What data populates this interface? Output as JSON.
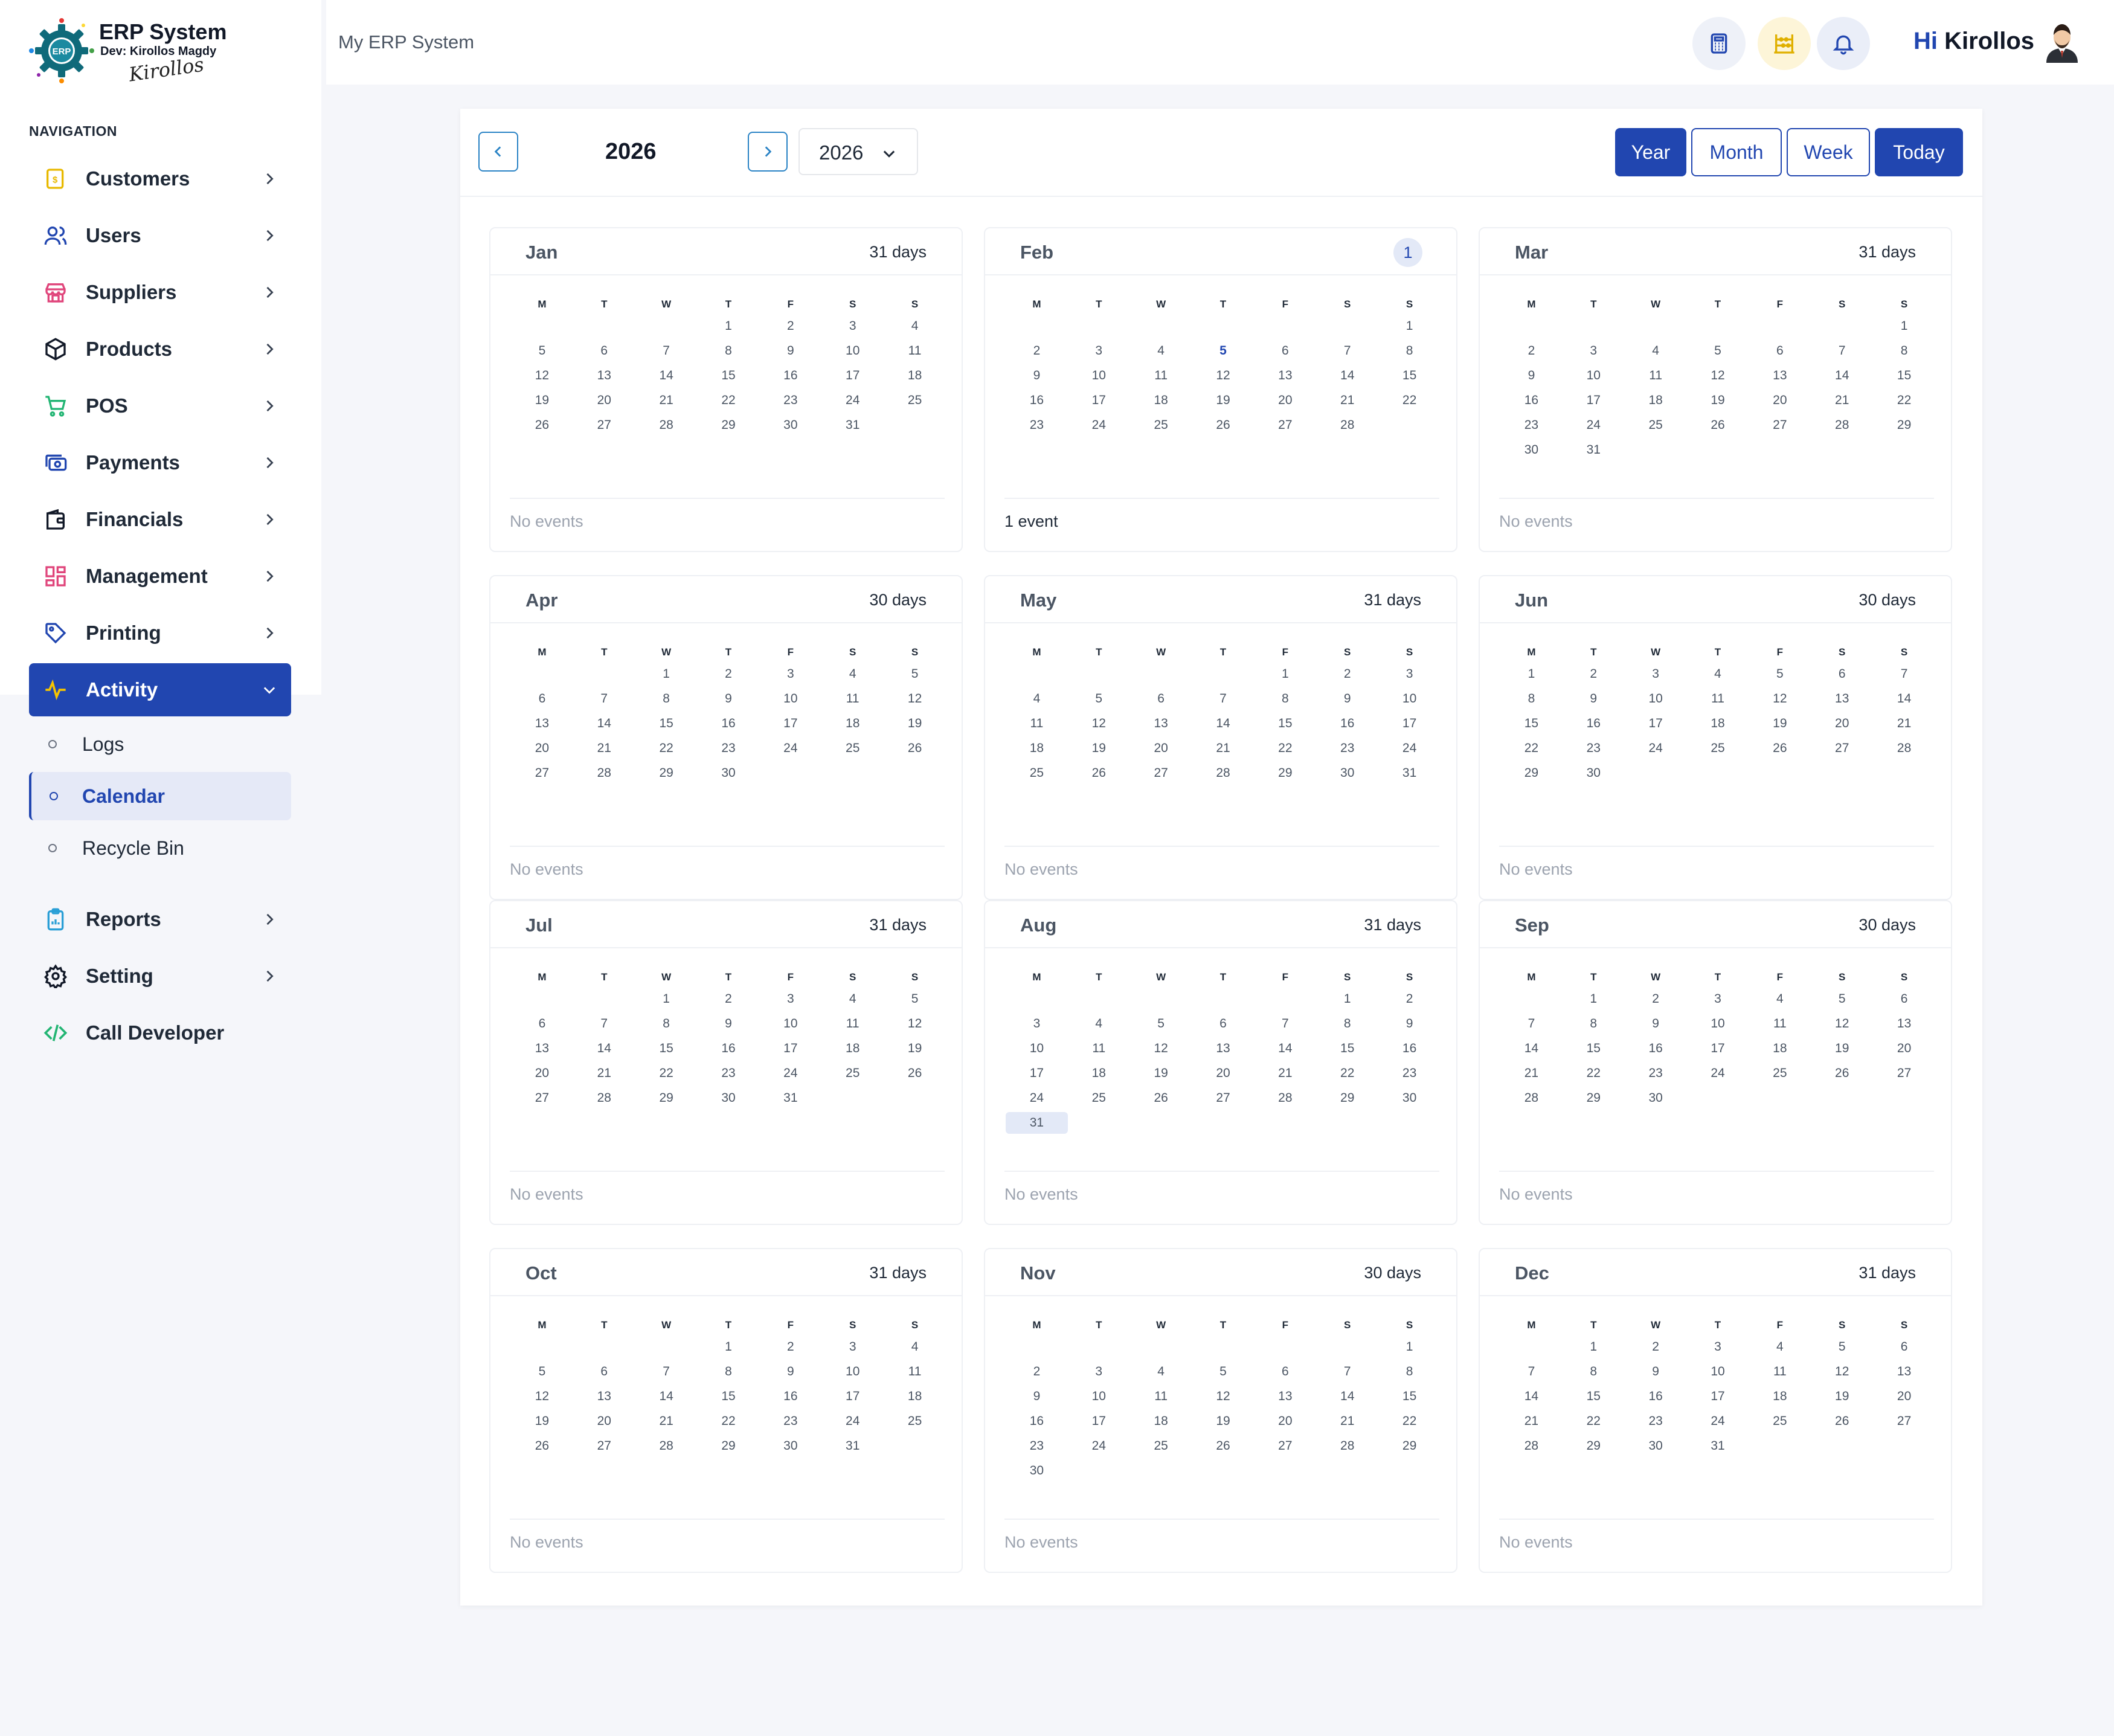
{
  "logo": {
    "title": "ERP System",
    "dev": "Dev: Kirollos Magdy",
    "badge": "ERP",
    "signature": "Kirollos"
  },
  "nav": {
    "heading": "NAVIGATION",
    "items": [
      {
        "label": "Customers",
        "icon": "customers-icon",
        "color": "#e8b900"
      },
      {
        "label": "Users",
        "icon": "users-icon",
        "color": "#2146b0"
      },
      {
        "label": "Suppliers",
        "icon": "suppliers-icon",
        "color": "#e0457b"
      },
      {
        "label": "Products",
        "icon": "products-icon",
        "color": "#111827"
      },
      {
        "label": "POS",
        "icon": "pos-cart-icon",
        "color": "#22b573"
      },
      {
        "label": "Payments",
        "icon": "payments-icon",
        "color": "#2146b0"
      },
      {
        "label": "Financials",
        "icon": "wallet-icon",
        "color": "#111827"
      },
      {
        "label": "Management",
        "icon": "management-grid-icon",
        "color": "#e0457b"
      },
      {
        "label": "Printing",
        "icon": "tag-icon",
        "color": "#2146b0"
      },
      {
        "label": "Activity",
        "icon": "activity-pulse-icon",
        "color": "#f5c400"
      },
      {
        "label": "Reports",
        "icon": "reports-clipboard-icon",
        "color": "#2a9fd6"
      },
      {
        "label": "Setting",
        "icon": "gear-icon",
        "color": "#111827"
      },
      {
        "label": "Call Developer",
        "icon": "code-icon",
        "color": "#22b573"
      }
    ],
    "activity_sub": [
      {
        "label": "Logs"
      },
      {
        "label": "Calendar"
      },
      {
        "label": "Recycle Bin"
      }
    ]
  },
  "header": {
    "brand": "My ERP System",
    "greeting_hi": "Hi",
    "greeting_name": "Kirollos",
    "buttons": [
      {
        "icon": "calculator-icon",
        "bg": "#eef1f8",
        "color": "#2146b0"
      },
      {
        "icon": "abacus-icon",
        "bg": "#fdf5d8",
        "color": "#e0b000"
      },
      {
        "icon": "bell-icon",
        "bg": "#eaeef8",
        "color": "#2146b0"
      }
    ]
  },
  "calendar": {
    "year_label": "2026",
    "year_select": "2026",
    "views": [
      "Year",
      "Month",
      "Week",
      "Today"
    ],
    "active_view": "Year",
    "weekday_headers": [
      "M",
      "T",
      "W",
      "T",
      "F",
      "S",
      "S"
    ],
    "today": {
      "month": 1,
      "day": 5
    },
    "highlight": {
      "month": 7,
      "day": 31
    },
    "months": [
      {
        "name": "Jan",
        "info": "31 days",
        "days": 31,
        "offset": 3,
        "events": "No events"
      },
      {
        "name": "Feb",
        "info": "1",
        "badge": true,
        "days": 28,
        "offset": 6,
        "events": "1 event"
      },
      {
        "name": "Mar",
        "info": "31 days",
        "days": 31,
        "offset": 6,
        "events": "No events"
      },
      {
        "name": "Apr",
        "info": "30 days",
        "days": 30,
        "offset": 2,
        "events": "No events"
      },
      {
        "name": "May",
        "info": "31 days",
        "days": 31,
        "offset": 4,
        "events": "No events"
      },
      {
        "name": "Jun",
        "info": "30 days",
        "days": 30,
        "offset": 0,
        "events": "No events"
      },
      {
        "name": "Jul",
        "info": "31 days",
        "days": 31,
        "offset": 2,
        "events": "No events"
      },
      {
        "name": "Aug",
        "info": "31 days",
        "days": 31,
        "offset": 5,
        "events": "No events"
      },
      {
        "name": "Sep",
        "info": "30 days",
        "days": 30,
        "offset": 1,
        "events": "No events"
      },
      {
        "name": "Oct",
        "info": "31 days",
        "days": 31,
        "offset": 3,
        "events": "No events"
      },
      {
        "name": "Nov",
        "info": "30 days",
        "days": 30,
        "offset": 6,
        "events": "No events"
      },
      {
        "name": "Dec",
        "info": "31 days",
        "days": 31,
        "offset": 1,
        "events": "No events"
      }
    ]
  }
}
